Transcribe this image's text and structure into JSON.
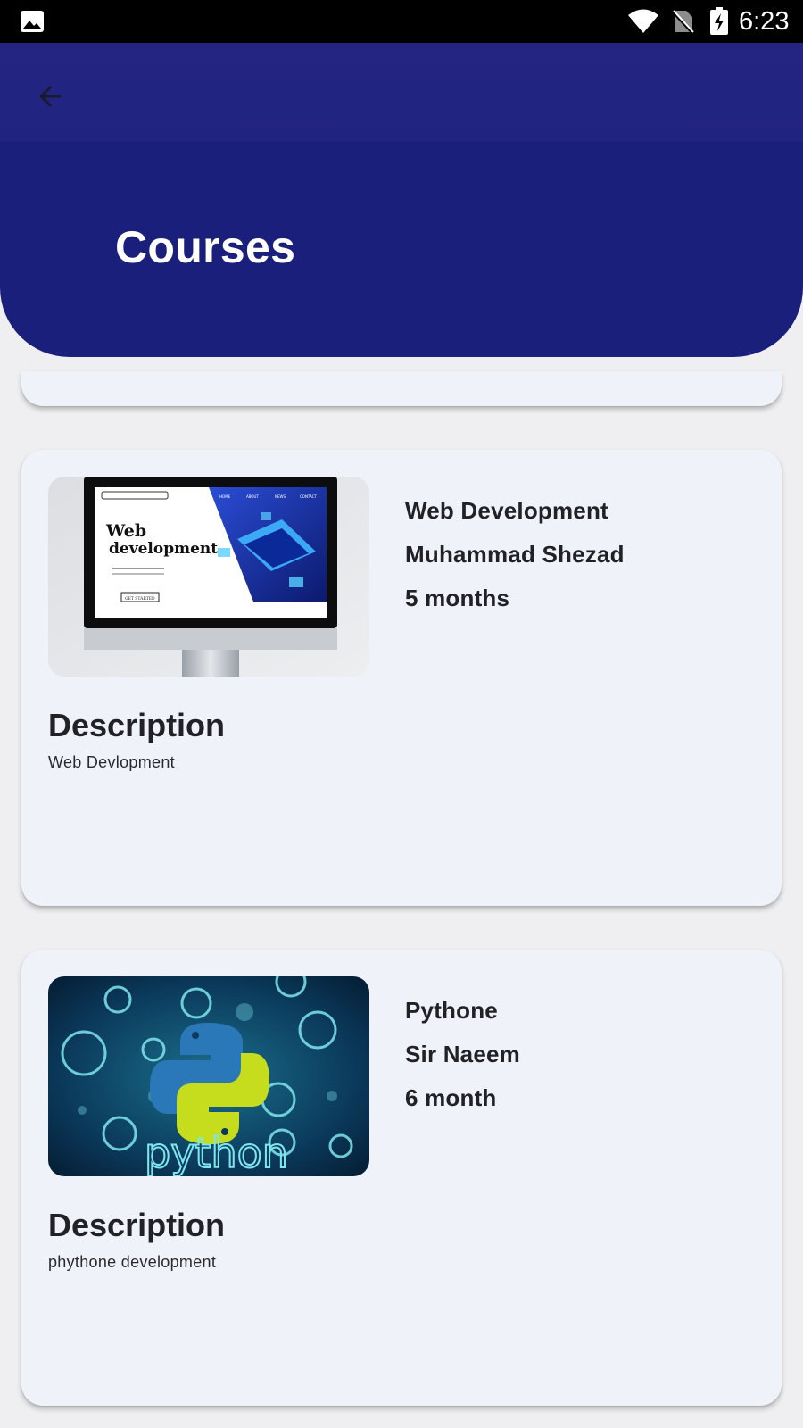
{
  "status_bar": {
    "time": "6:23",
    "icons": [
      "gallery-icon",
      "wifi-icon",
      "no-sim-icon",
      "battery-charging-icon"
    ]
  },
  "header": {
    "title": "Courses",
    "back_icon": "arrow-left-icon"
  },
  "courses": [
    {
      "name": "Web Development",
      "teacher": "Muhammad Shezad",
      "duration": "5 months",
      "description_heading": "Description",
      "description": "Web Devlopment",
      "thumbnail": {
        "headline_line1": "Web",
        "headline_line2": "development",
        "nav": [
          "HOME",
          "ABOUT",
          "NEWS",
          "CONTACT"
        ],
        "cta": "GET STARTED"
      }
    },
    {
      "name": "Pythone",
      "teacher": "Sir Naeem",
      "duration": "6 month",
      "description_heading": "Description",
      "description": "phythone development",
      "thumbnail": {
        "word": "python"
      }
    }
  ],
  "colors": {
    "header": "#1a1f7b",
    "card": "#eff2f9",
    "background": "#efeff1"
  }
}
